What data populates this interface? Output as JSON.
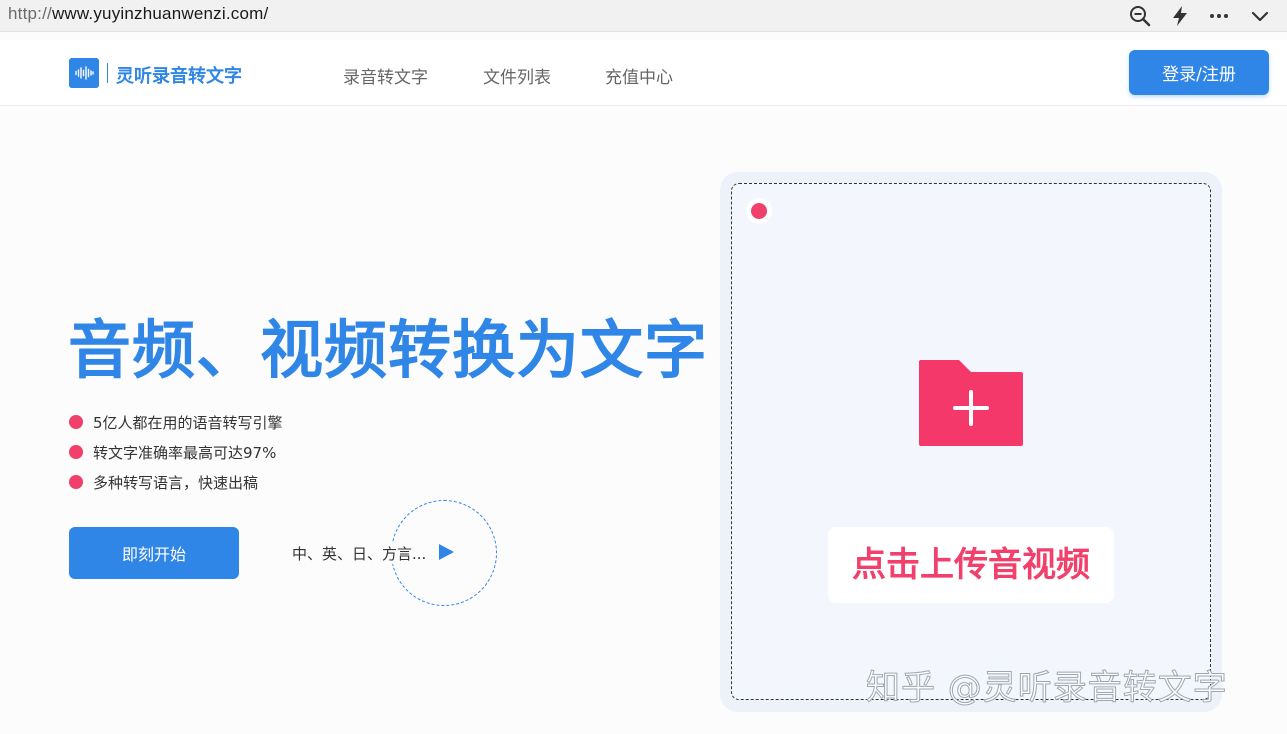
{
  "browser": {
    "url_protocol": "http://",
    "url_rest": "www.yuyinzhuanwenzi.com/",
    "icons": [
      "zoom-out-icon",
      "lightning-icon",
      "more-icon",
      "chevron-down-icon"
    ]
  },
  "header": {
    "logo_text": "灵听录音转文字",
    "nav": [
      {
        "label": "录音转文字"
      },
      {
        "label": "文件列表"
      },
      {
        "label": "充值中心"
      }
    ],
    "login_label": "登录/注册"
  },
  "hero": {
    "headline": "音频、视频转换为文字",
    "features": [
      "5亿人都在用的语音转写引擎",
      "转文字准确率最高可达97%",
      "多种转写语言，快速出稿"
    ],
    "start_label": "即刻开始",
    "languages": "中、英、日、方言..."
  },
  "upload": {
    "label": "点击上传音视频"
  },
  "watermark": "知乎 @灵听录音转文字",
  "colors": {
    "primary": "#2f86e6",
    "accent": "#f0406b"
  }
}
